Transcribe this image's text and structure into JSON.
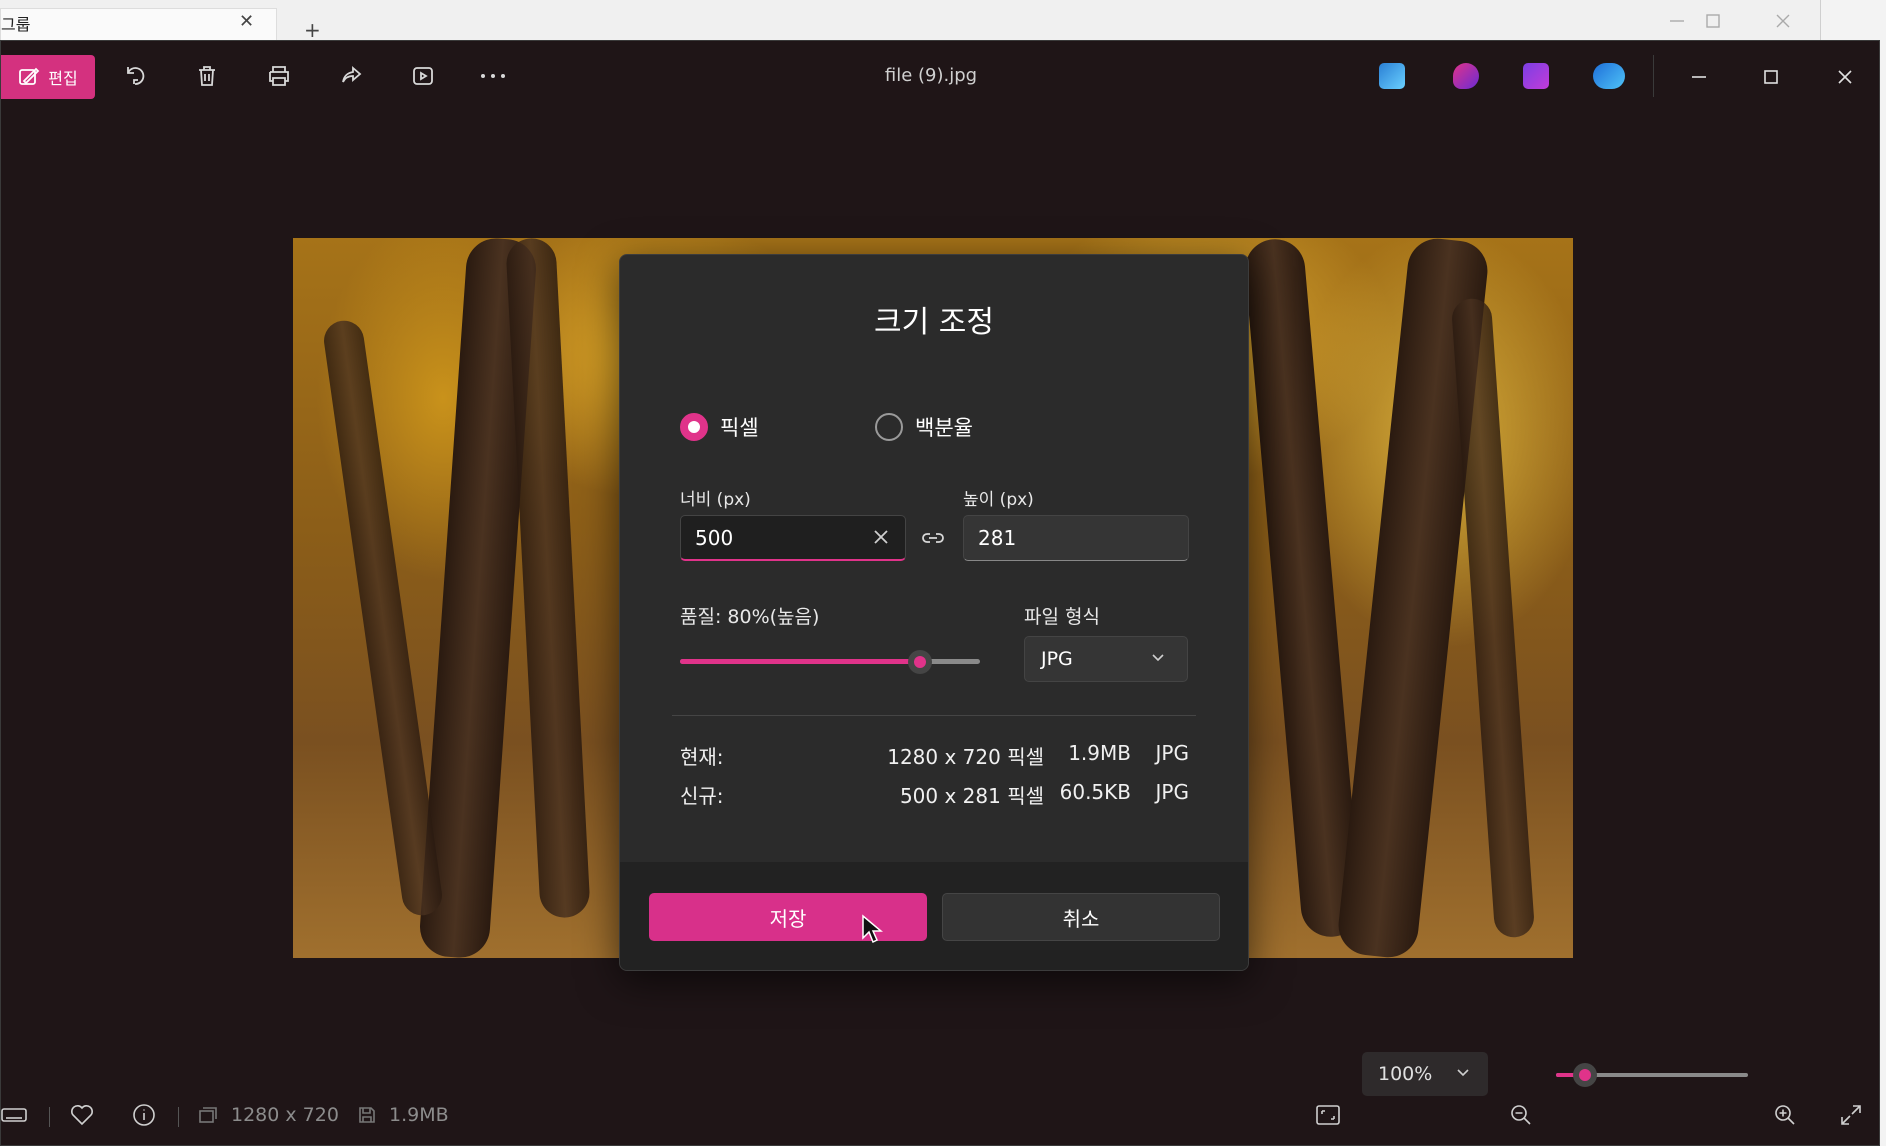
{
  "background_window": {
    "tab_title": "그룹",
    "close_glyph": "✕",
    "new_tab_glyph": "+"
  },
  "toolbar": {
    "edit_label": "편집",
    "file_title": "file (9).jpg"
  },
  "dialog": {
    "title": "크기 조정",
    "mode_pixels": "픽셀",
    "mode_percent": "백분율",
    "selected_mode": "pixels",
    "width_label": "너비 (px)",
    "height_label": "높이 (px)",
    "width_value": "500",
    "height_value": "281",
    "quality_label": "품질: 80%(높음)",
    "quality_fraction": 0.8,
    "format_label": "파일 형식",
    "format_value": "JPG",
    "current_label": "현재:",
    "current_dims": "1280 x 720 픽셀",
    "current_size": "1.9MB",
    "current_format": "JPG",
    "new_label": "신규:",
    "new_dims": "500 x 281 픽셀",
    "new_size": "60.5KB",
    "new_format": "JPG",
    "save_label": "저장",
    "cancel_label": "취소"
  },
  "statusbar": {
    "dimensions": "1280 x 720",
    "file_size": "1.9MB",
    "zoom_value": "100%",
    "zoom_fraction": 0.15
  },
  "colors": {
    "accent": "#d8308a",
    "app_background": "#1f1517",
    "dialog_background": "#2b2b2b"
  }
}
